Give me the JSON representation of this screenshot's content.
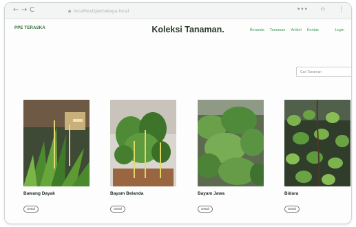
{
  "browser": {
    "nav": {
      "back": "←",
      "forward": "→",
      "reload": "C"
    },
    "address": "localhost/pertekaya.local",
    "right_icons": [
      "•••",
      "☆",
      "⋮"
    ]
  },
  "header": {
    "logo_title": "PPE TERASKA",
    "logo_subtitle": "",
    "title": "Koleksi Tanaman.",
    "nav_items": [
      "Beranda",
      "Tanaman",
      "Artikel",
      "Kontak"
    ],
    "login_label": "Login"
  },
  "description": "",
  "search": {
    "placeholder": "Cari Tanaman"
  },
  "cards": [
    {
      "name": "Bawang Dayak",
      "latin": "",
      "button": "Detail"
    },
    {
      "name": "Bayam Belanda",
      "latin": "",
      "button": "Detail"
    },
    {
      "name": "Bayam Jawa",
      "latin": "",
      "button": "Detail"
    },
    {
      "name": "Bidara",
      "latin": "",
      "button": "Detail"
    }
  ],
  "colors": {
    "accent": "#3f9a52",
    "logo": "#2d6b33",
    "title": "#2a3a2c"
  }
}
